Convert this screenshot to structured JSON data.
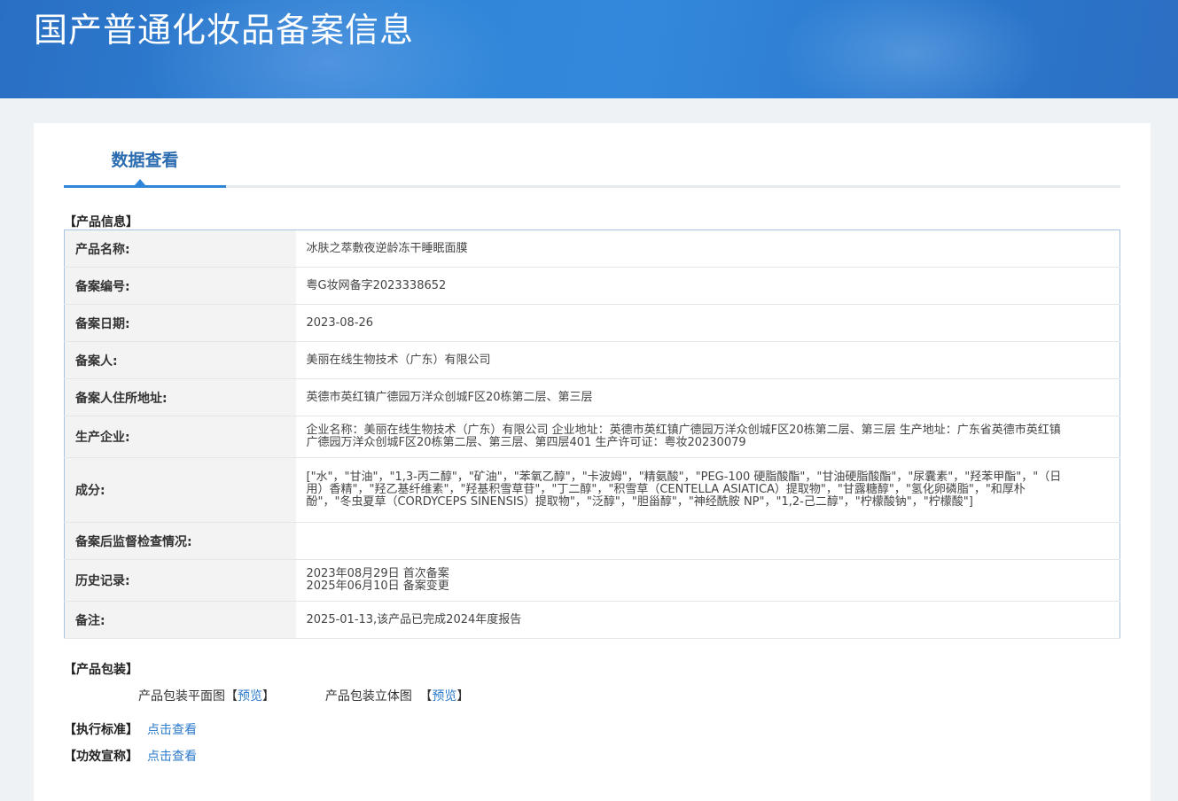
{
  "header": {
    "title": "国产普通化妆品备案信息"
  },
  "tabs": [
    {
      "label": "数据查看"
    }
  ],
  "product_info": {
    "section_title": "【产品信息】",
    "rows": [
      {
        "label": "产品名称:",
        "value": "冰肤之萃敷夜逆龄冻干睡眠面膜"
      },
      {
        "label": "备案编号:",
        "value": "粤G妆网备字2023338652"
      },
      {
        "label": "备案日期:",
        "value": "2023-08-26"
      },
      {
        "label": "备案人:",
        "value": "美丽在线生物技术（广东）有限公司"
      },
      {
        "label": "备案人住所地址:",
        "value": "英德市英红镇广德园万洋众创城F区20栋第二层、第三层"
      },
      {
        "label": "生产企业:",
        "value": "企业名称：美丽在线生物技术（广东）有限公司 企业地址：英德市英红镇广德园万洋众创城F区20栋第二层、第三层 生产地址：广东省英德市英红镇广德园万洋众创城F区20栋第二层、第三层、第四层401 生产许可证：粤妆20230079"
      },
      {
        "label": "成分:",
        "value": "[\"水\"，\"甘油\"，\"1,3-丙二醇\"，\"矿油\"，\"苯氧乙醇\"，\"卡波姆\"，\"精氨酸\"，\"PEG-100 硬脂酸酯\"，\"甘油硬脂酸酯\"，\"尿囊素\"，\"羟苯甲酯\"，\"（日用）香精\"，\"羟乙基纤维素\"，\"羟基积雪草苷\"，\"丁二醇\"，\"积雪草（CENTELLA ASIATICA）提取物\"，\"甘露糖醇\"，\"氢化卵磷脂\"，\"和厚朴酚\"，\"冬虫夏草（CORDYCEPS SINENSIS）提取物\"，\"泛醇\"，\"胆甾醇\"，\"神经酰胺 NP\"，\"1,2-己二醇\"，\"柠檬酸钠\"，\"柠檬酸\"]"
      },
      {
        "label": "备案后监督检查情况:",
        "value": ""
      },
      {
        "label": "历史记录:",
        "value": ""
      },
      {
        "label": "备注:",
        "value": "2025-01-13,该产品已完成2024年度报告"
      }
    ],
    "history": [
      "2023年08月29日 首次备案",
      "2025年06月10日 备案变更"
    ]
  },
  "packaging": {
    "section_title": "【产品包装】",
    "flat_label": "产品包装平面图",
    "solid_label": "产品包装立体图",
    "bracket_open": "【",
    "bracket_close": "】",
    "preview_label": "预览"
  },
  "standard": {
    "section_title": "【执行标准】",
    "link_label": "点击查看"
  },
  "efficacy": {
    "section_title": "【功效宣称】",
    "link_label": "点击查看"
  }
}
